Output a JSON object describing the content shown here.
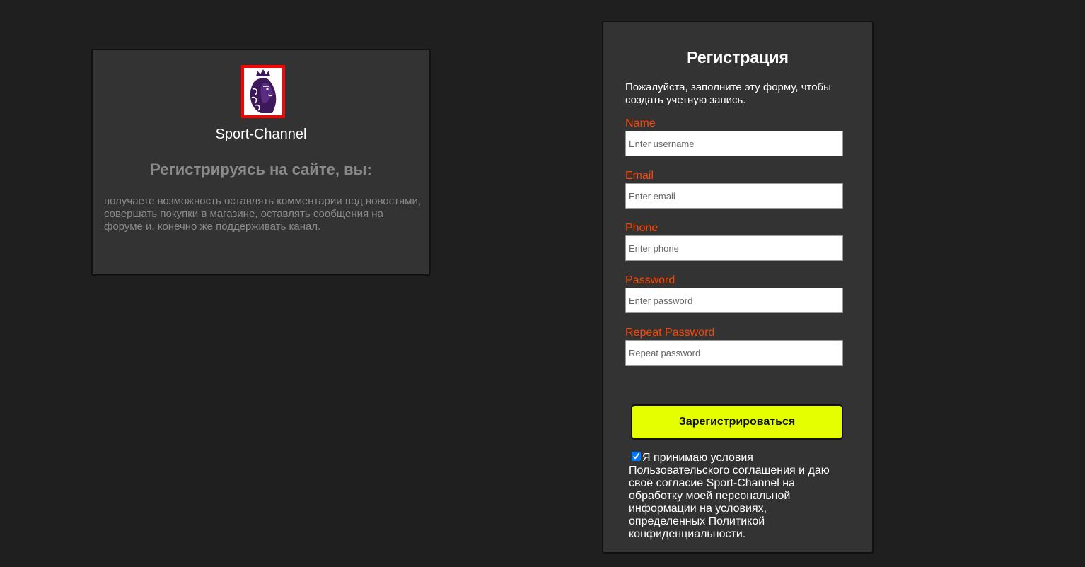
{
  "info": {
    "logo_icon": "premier-league-lion-icon",
    "brand": "Sport-Channel",
    "heading": "Регистрируясь на сайте, вы:",
    "text": "получаете возможность оставлять комментарии под новостями, совершать покупки в магазине, оставлять сообщения на форуме и, конечно же поддерживать канал."
  },
  "form": {
    "title": "Регистрация",
    "intro": "Пожалуйста, заполните эту форму, чтобы создать учетную запись.",
    "fields": [
      {
        "label": "Name",
        "placeholder": "Enter username"
      },
      {
        "label": "Email",
        "placeholder": "Enter email"
      },
      {
        "label": "Phone",
        "placeholder": "Enter phone"
      },
      {
        "label": "Password",
        "placeholder": "Enter password"
      },
      {
        "label": "Repeat Password",
        "placeholder": "Repeat password"
      }
    ],
    "submit_label": "Зарегистрироваться",
    "consent_checked": true,
    "consent_text": "Я принимаю условия Пользовательского соглашения и даю своё согласие Sport-Channel на обработку моей персональной информации на условиях, определенных Политикой конфиденциальности."
  },
  "colors": {
    "background": "#1f1f1f",
    "card": "#333333",
    "label_accent": "#ff4400",
    "button": "#e6ff00",
    "logo_border": "#ff0000",
    "logo_purple": "#3d195b"
  }
}
